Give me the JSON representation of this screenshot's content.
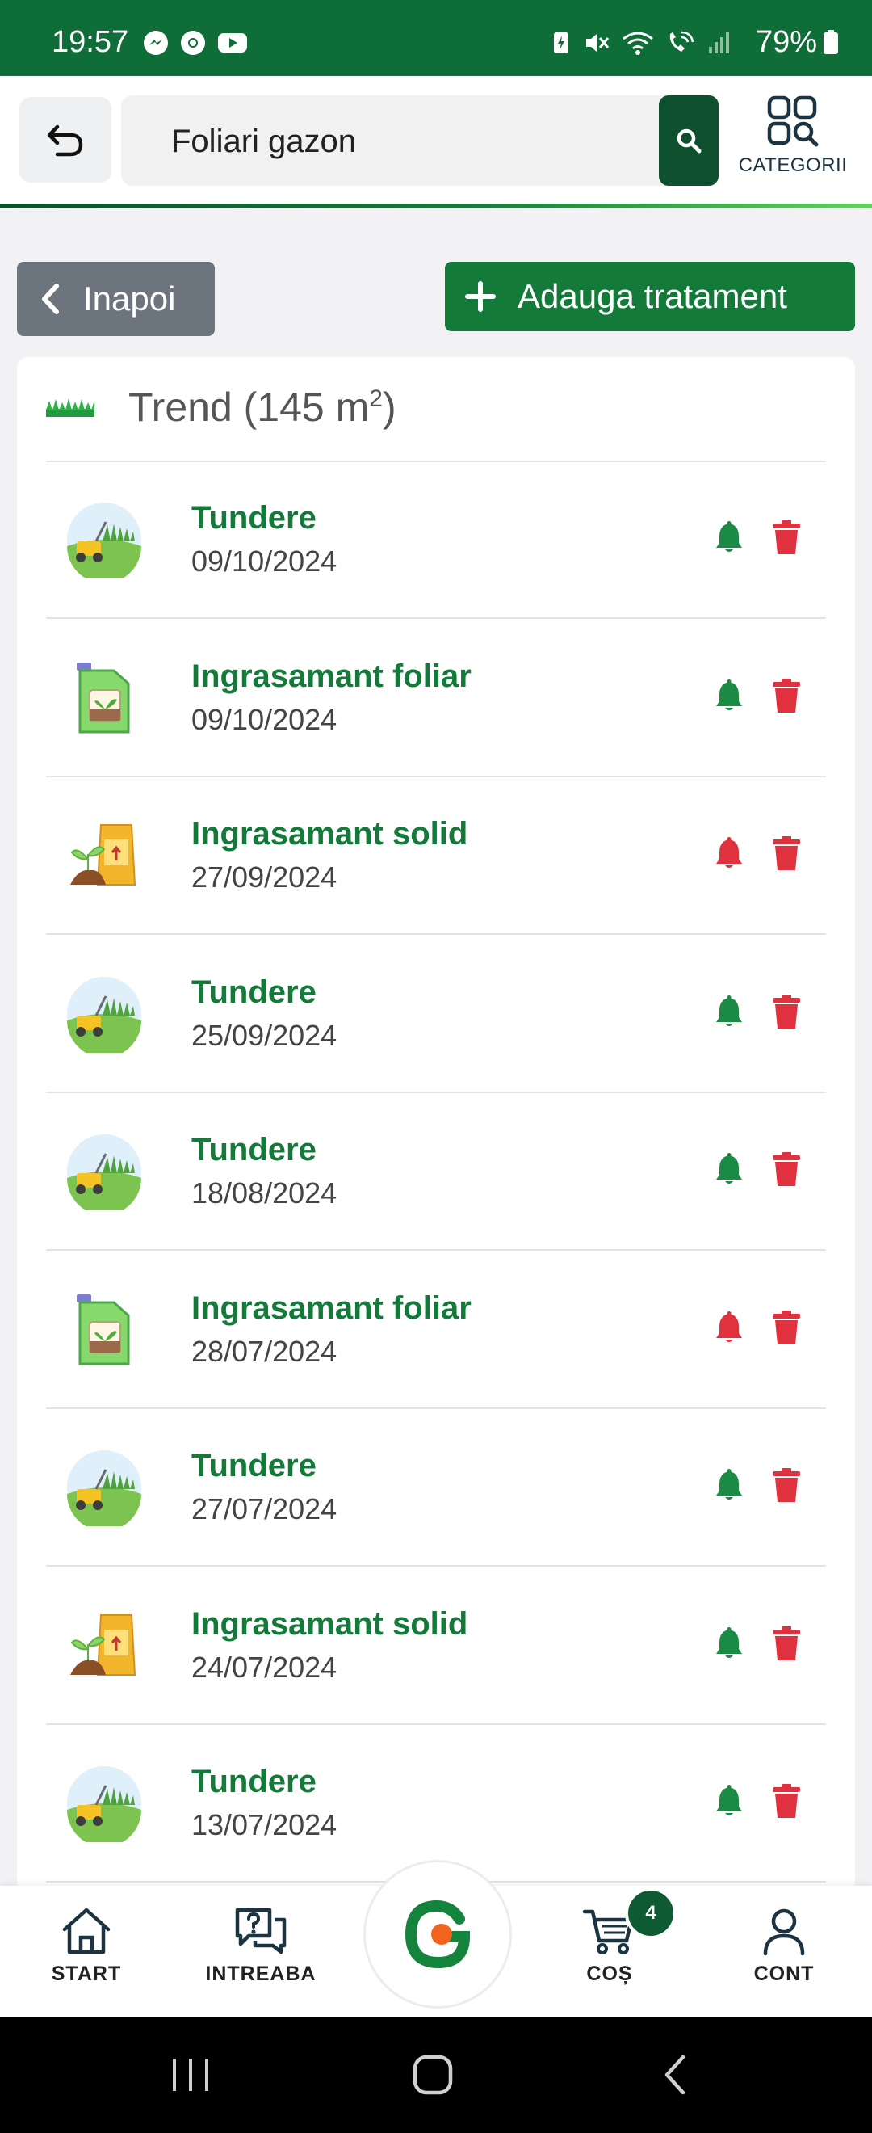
{
  "status_bar": {
    "time": "19:57",
    "battery": "79%"
  },
  "search": {
    "value": "Foliari gazon",
    "placeholder": ""
  },
  "categories_label": "CATEGORII",
  "actions": {
    "back_label": "Inapoi",
    "add_label": "Adauga tratament"
  },
  "garden": {
    "title": "Trend (145 m",
    "superscript": "2",
    "suffix": ")"
  },
  "treatments": [
    {
      "name": "Tundere",
      "date": "09/10/2024",
      "icon": "mower-icon",
      "reminder_active": true
    },
    {
      "name": "Ingrasamant foliar",
      "date": "09/10/2024",
      "icon": "liquid-fertilizer-icon",
      "reminder_active": true
    },
    {
      "name": "Ingrasamant solid",
      "date": "27/09/2024",
      "icon": "solid-fertilizer-icon",
      "reminder_active": false
    },
    {
      "name": "Tundere",
      "date": "25/09/2024",
      "icon": "mower-icon",
      "reminder_active": true
    },
    {
      "name": "Tundere",
      "date": "18/08/2024",
      "icon": "mower-icon",
      "reminder_active": true
    },
    {
      "name": "Ingrasamant foliar",
      "date": "28/07/2024",
      "icon": "liquid-fertilizer-icon",
      "reminder_active": false
    },
    {
      "name": "Tundere",
      "date": "27/07/2024",
      "icon": "mower-icon",
      "reminder_active": true
    },
    {
      "name": "Ingrasamant solid",
      "date": "24/07/2024",
      "icon": "solid-fertilizer-icon",
      "reminder_active": true
    },
    {
      "name": "Tundere",
      "date": "13/07/2024",
      "icon": "mower-icon",
      "reminder_active": true
    }
  ],
  "bottom_nav": {
    "start": "START",
    "ask": "INTREABA",
    "cart": "COȘ",
    "account": "CONT",
    "cart_count": "4"
  },
  "colors": {
    "brand_green": "#137a3a",
    "dark_green": "#0e4f2e",
    "bell_active": "#1a8a45",
    "bell_inactive": "#e0313f",
    "trash": "#e0313f"
  }
}
